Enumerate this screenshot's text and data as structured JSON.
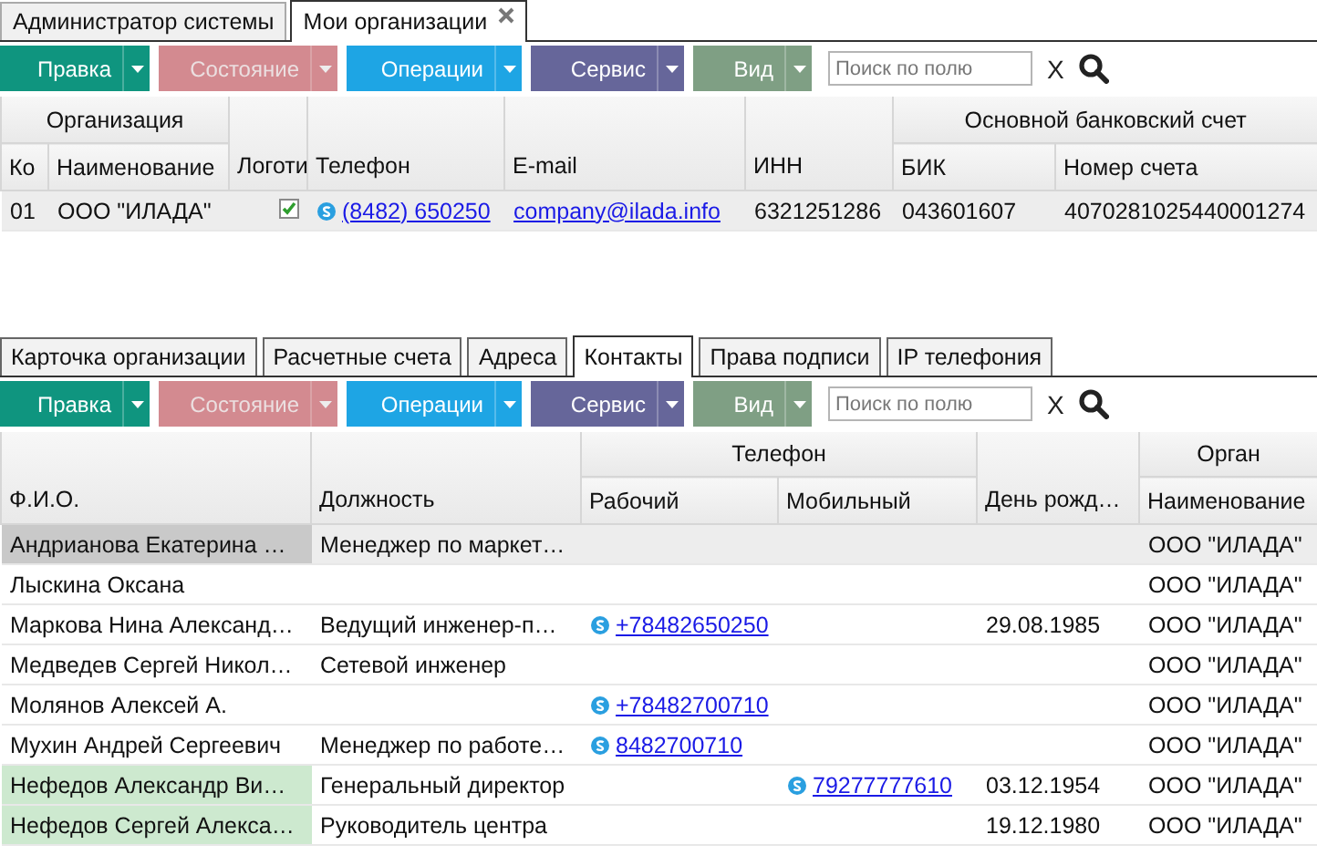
{
  "top_tabs": [
    {
      "label": "Администратор системы",
      "selected": false,
      "closable": false
    },
    {
      "label": "Мои организации",
      "selected": true,
      "closable": true
    }
  ],
  "organizations_toolbar": {
    "buttons": [
      {
        "label": "Правка",
        "color": "#0f957f",
        "disabled": false
      },
      {
        "label": "Состояние",
        "color": "#e3949b",
        "disabled": true
      },
      {
        "label": "Операции",
        "color": "#1ea5e4",
        "disabled": false
      },
      {
        "label": "Сервис",
        "color": "#66669a",
        "disabled": false
      },
      {
        "label": "Вид",
        "color": "#7f9f84",
        "disabled": false
      }
    ],
    "search": {
      "placeholder": "Поиск по полю"
    },
    "clear": "X"
  },
  "organizations_table": {
    "column_groups": [
      {
        "label": "Организация",
        "columns": [
          {
            "label": "Ко"
          },
          {
            "label": "Наименование"
          }
        ]
      },
      {
        "columns": [
          {
            "label": "Логоти"
          }
        ]
      },
      {
        "columns": [
          {
            "label": "Телефон"
          }
        ]
      },
      {
        "columns": [
          {
            "label": "E-mail"
          }
        ]
      },
      {
        "columns": [
          {
            "label": "ИНН"
          }
        ]
      },
      {
        "label": "Основной банковский счет",
        "columns": [
          {
            "label": "БИК"
          },
          {
            "label": "Номер счета"
          }
        ]
      }
    ],
    "rows": [
      {
        "selected": true,
        "cells": [
          {
            "kind": "text",
            "text": "01"
          },
          {
            "kind": "text",
            "text": "ООО \"ИЛАДА\""
          },
          {
            "kind": "check",
            "checked": true
          },
          {
            "kind": "phone",
            "text": "(8482) 650250"
          },
          {
            "kind": "link",
            "text": "company@ilada.info"
          },
          {
            "kind": "text",
            "text": "6321251286"
          },
          {
            "kind": "text",
            "text": "043601607"
          },
          {
            "kind": "text",
            "text": "4070281025440001274"
          }
        ]
      }
    ]
  },
  "detail_tabs": [
    {
      "label": "Карточка организации",
      "selected": false
    },
    {
      "label": "Расчетные счета",
      "selected": false
    },
    {
      "label": "Адреса",
      "selected": false
    },
    {
      "label": "Контакты",
      "selected": true
    },
    {
      "label": "Права подписи",
      "selected": false
    },
    {
      "label": "IP телефония",
      "selected": false
    }
  ],
  "contacts_toolbar": {
    "buttons": [
      {
        "label": "Правка",
        "color": "#0f957f",
        "disabled": false
      },
      {
        "label": "Состояние",
        "color": "#e3949b",
        "disabled": true
      },
      {
        "label": "Операции",
        "color": "#1ea5e4",
        "disabled": false
      },
      {
        "label": "Сервис",
        "color": "#66669a",
        "disabled": false
      },
      {
        "label": "Вид",
        "color": "#7f9f84",
        "disabled": false
      }
    ],
    "search": {
      "placeholder": "Поиск по полю"
    },
    "clear": "X"
  },
  "contacts_table": {
    "column_groups": [
      {
        "columns": [
          {
            "label": "Ф.И.О."
          }
        ]
      },
      {
        "columns": [
          {
            "label": "Должность"
          }
        ]
      },
      {
        "label": "Телефон",
        "columns": [
          {
            "label": "Рабочий"
          },
          {
            "label": "Мобильный"
          }
        ]
      },
      {
        "columns": [
          {
            "label": "День рожд…"
          }
        ]
      },
      {
        "label": "Орган",
        "columns": [
          {
            "label": "Наименование"
          }
        ]
      }
    ],
    "rows": [
      {
        "selected": true,
        "highlighted": false,
        "cells": [
          {
            "kind": "text",
            "text": "Андрианова Екатерина …"
          },
          {
            "kind": "text",
            "text": "Менеджер по маркет…"
          },
          {
            "kind": "blank"
          },
          {
            "kind": "blank"
          },
          {
            "kind": "blank"
          },
          {
            "kind": "text",
            "text": "ООО \"ИЛАДА\""
          }
        ]
      },
      {
        "selected": false,
        "highlighted": false,
        "cells": [
          {
            "kind": "text",
            "text": "Лыскина Оксана"
          },
          {
            "kind": "blank"
          },
          {
            "kind": "blank"
          },
          {
            "kind": "blank"
          },
          {
            "kind": "blank"
          },
          {
            "kind": "text",
            "text": "ООО \"ИЛАДА\""
          }
        ]
      },
      {
        "selected": false,
        "highlighted": false,
        "cells": [
          {
            "kind": "text",
            "text": "Маркова Нина Александ…"
          },
          {
            "kind": "text",
            "text": "Ведущий инженер-п…"
          },
          {
            "kind": "phone",
            "text": "+78482650250"
          },
          {
            "kind": "blank"
          },
          {
            "kind": "text",
            "text": "29.08.1985"
          },
          {
            "kind": "text",
            "text": "ООО \"ИЛАДА\""
          }
        ]
      },
      {
        "selected": false,
        "highlighted": false,
        "cells": [
          {
            "kind": "text",
            "text": "Медведев Сергей Никол…"
          },
          {
            "kind": "text",
            "text": "Сетевой инженер"
          },
          {
            "kind": "blank"
          },
          {
            "kind": "blank"
          },
          {
            "kind": "blank"
          },
          {
            "kind": "text",
            "text": "ООО \"ИЛАДА\""
          }
        ]
      },
      {
        "selected": false,
        "highlighted": false,
        "cells": [
          {
            "kind": "text",
            "text": "Молянов Алексей А."
          },
          {
            "kind": "blank"
          },
          {
            "kind": "phone",
            "text": "+78482700710"
          },
          {
            "kind": "blank"
          },
          {
            "kind": "blank"
          },
          {
            "kind": "text",
            "text": "ООО \"ИЛАДА\""
          }
        ]
      },
      {
        "selected": false,
        "highlighted": false,
        "cells": [
          {
            "kind": "text",
            "text": "Мухин Андрей Сергеевич"
          },
          {
            "kind": "text",
            "text": "Менеджер по работе…"
          },
          {
            "kind": "phone",
            "text": "8482700710"
          },
          {
            "kind": "blank"
          },
          {
            "kind": "blank"
          },
          {
            "kind": "text",
            "text": "ООО \"ИЛАДА\""
          }
        ]
      },
      {
        "selected": false,
        "highlighted": true,
        "cells": [
          {
            "kind": "text",
            "text": "Нефедов Александр Ви…"
          },
          {
            "kind": "text",
            "text": "Генеральный директор"
          },
          {
            "kind": "blank"
          },
          {
            "kind": "phone",
            "text": "79277777610"
          },
          {
            "kind": "text",
            "text": "03.12.1954"
          },
          {
            "kind": "text",
            "text": "ООО \"ИЛАДА\""
          }
        ]
      },
      {
        "selected": false,
        "highlighted": true,
        "cells": [
          {
            "kind": "text",
            "text": "Нефедов Сергей Алекса…"
          },
          {
            "kind": "text",
            "text": "Руководитель центра"
          },
          {
            "kind": "blank"
          },
          {
            "kind": "blank"
          },
          {
            "kind": "text",
            "text": "19.12.1980"
          },
          {
            "kind": "text",
            "text": "ООО \"ИЛАДА\""
          }
        ]
      }
    ]
  }
}
